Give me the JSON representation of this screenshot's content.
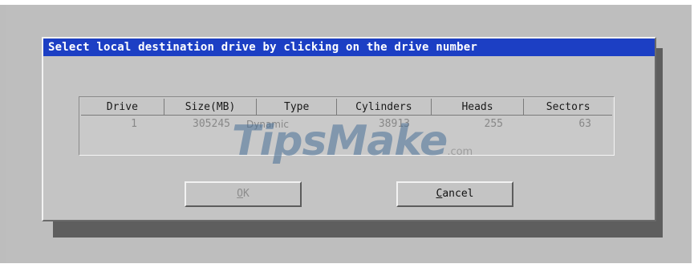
{
  "dialog": {
    "title": "Select local destination drive by clicking on the drive number"
  },
  "table": {
    "headers": [
      "Drive",
      "Size(MB)",
      "Type",
      "Cylinders",
      "Heads",
      "Sectors"
    ],
    "rows": [
      {
        "drive": "1",
        "size_mb": "305245",
        "type": "Dynamic",
        "cylinders": "38913",
        "heads": "255",
        "sectors": "63"
      }
    ]
  },
  "buttons": {
    "ok": {
      "accel": "O",
      "rest": "K",
      "enabled": false
    },
    "cancel": {
      "accel": "C",
      "rest": "ancel",
      "enabled": true
    }
  },
  "watermark": {
    "main": "TipsMake",
    "suffix": ".com"
  },
  "colors": {
    "title_bar": "#1c3fc4",
    "dialog_bg": "#c4c4c4",
    "disabled_text": "#888888"
  }
}
